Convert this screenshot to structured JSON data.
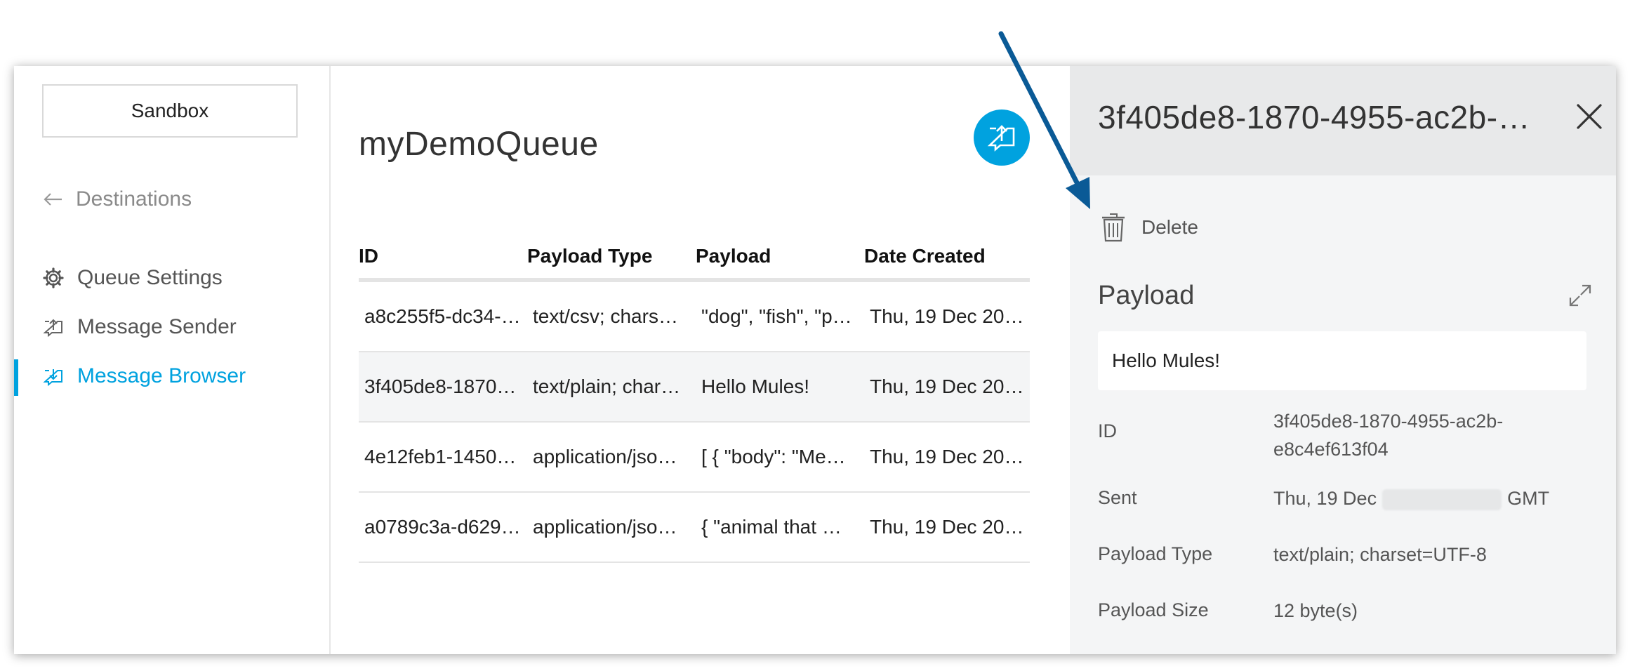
{
  "sidebar": {
    "environment_label": "Sandbox",
    "back_label": "Destinations",
    "nav": [
      {
        "label": "Queue Settings",
        "icon": "gear-icon"
      },
      {
        "label": "Message Sender",
        "icon": "message-send-icon"
      },
      {
        "label": "Message Browser",
        "icon": "message-browse-icon",
        "active": true
      }
    ]
  },
  "main": {
    "queue_name": "myDemoQueue",
    "send_button_icon": "send-message-icon",
    "table": {
      "columns": [
        "ID",
        "Payload Type",
        "Payload",
        "Date Created"
      ],
      "rows": [
        {
          "id": "a8c255f5-dc34-…",
          "payload_type": "text/csv; chars…",
          "payload": "\"dog\", \"fish\", \"p…",
          "date": "Thu, 19 Dec 20…"
        },
        {
          "id": "3f405de8-1870…",
          "payload_type": "text/plain; char…",
          "payload": "Hello Mules!",
          "date": "Thu, 19 Dec 20…",
          "selected": true
        },
        {
          "id": "4e12feb1-1450…",
          "payload_type": "application/jso…",
          "payload": "[ { \"body\": \"Me…",
          "date": "Thu, 19 Dec 20…"
        },
        {
          "id": "a0789c3a-d629…",
          "payload_type": "application/jso…",
          "payload": "{ \"animal that …",
          "date": "Thu, 19 Dec 20…"
        }
      ]
    }
  },
  "detail": {
    "title": "3f405de8-1870-4955-ac2b-e…",
    "delete_label": "Delete",
    "payload_heading": "Payload",
    "payload_value": "Hello Mules!",
    "meta": {
      "id_label": "ID",
      "id_line1": "3f405de8-1870-4955-ac2b-",
      "id_line2": "e8c4ef613f04",
      "sent_label": "Sent",
      "sent_prefix": "Thu, 19 Dec",
      "sent_suffix": "GMT",
      "type_label": "Payload Type",
      "type_value": "text/plain; charset=UTF-8",
      "size_label": "Payload Size",
      "size_value": "12 byte(s)"
    }
  },
  "colors": {
    "accent": "#00a2df",
    "annotation_arrow": "#0a5a96"
  }
}
